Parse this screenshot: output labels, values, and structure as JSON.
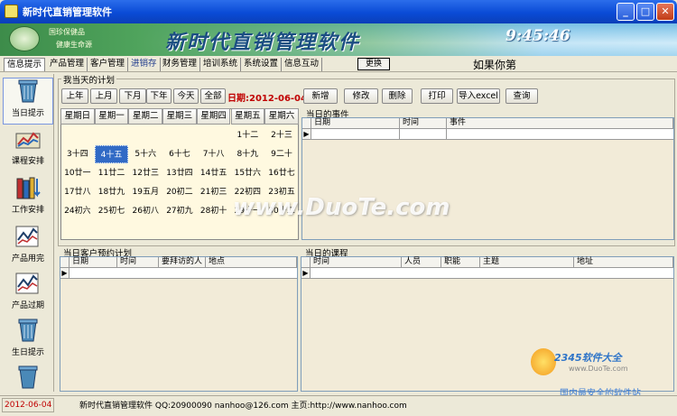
{
  "window": {
    "title": "新时代直销管理软件"
  },
  "banner": {
    "slogan1": "国珍保健品",
    "slogan2": "健康生命源",
    "title": "新时代直销管理软件",
    "clock": "9:45:46"
  },
  "menu": {
    "tabs": [
      "信息提示",
      "产品管理",
      "客户管理",
      "进销存",
      "财务管理",
      "培训系统",
      "系统设置",
      "信息互动"
    ],
    "change_button": "更换",
    "motto": "如果你第"
  },
  "sidebar": {
    "items": [
      {
        "label": "当日提示",
        "icon": "trash-can-icon"
      },
      {
        "label": "课程安排",
        "icon": "chart-book-icon"
      },
      {
        "label": "工作安排",
        "icon": "books-arrow-icon"
      },
      {
        "label": "产品用完",
        "icon": "clipboard-graph-icon"
      },
      {
        "label": "产品过期",
        "icon": "clipboard-graph-icon"
      },
      {
        "label": "生日提示",
        "icon": "trash-can-icon"
      }
    ]
  },
  "plan": {
    "group_label": "我当天的计划",
    "nav_buttons": [
      "上年",
      "上月",
      "下月",
      "下年",
      "今天",
      "全部"
    ],
    "date_label": "日期:2012-06-04",
    "action_buttons": [
      "新增",
      "修改",
      "删除",
      "打印",
      "导入excel",
      "查询"
    ]
  },
  "calendar": {
    "weekdays": [
      "星期日",
      "星期一",
      "星期二",
      "星期三",
      "星期四",
      "星期五",
      "星期六"
    ],
    "rows": [
      [
        "",
        "",
        "",
        "",
        "",
        "1十二",
        "2十三"
      ],
      [
        "3十四",
        "4十五",
        "5十六",
        "6十七",
        "7十八",
        "8十九",
        "9二十"
      ],
      [
        "10廿一",
        "11廿二",
        "12廿三",
        "13廿四",
        "14廿五",
        "15廿六",
        "16廿七"
      ],
      [
        "17廿八",
        "18廿九",
        "19五月",
        "20初二",
        "21初三",
        "22初四",
        "23初五"
      ],
      [
        "24初六",
        "25初七",
        "26初八",
        "27初九",
        "28初十",
        "29十一",
        "30十二"
      ]
    ],
    "selected_day": "4十五"
  },
  "events": {
    "group_label": "当日的事件",
    "columns": [
      "日期",
      "时间",
      "事件"
    ]
  },
  "appointments": {
    "group_label": "当日客户预约计划",
    "columns": [
      "日期",
      "时间",
      "要拜访的人",
      "地点"
    ]
  },
  "courses": {
    "group_label": "当日的课程",
    "columns": [
      "时间",
      "人员",
      "职能",
      "主题",
      "地址"
    ]
  },
  "watermark": {
    "main": "www.DuoTe.com",
    "brand": "2345软件大全",
    "brand_sub": "www.DuoTe.com",
    "tagline": "国内最安全的软件站"
  },
  "status": {
    "date": "2012-06-04",
    "info": "新时代直销管理软件 QQ:20900090 nanhoo@126.com 主页:http://www.nanhoo.com"
  },
  "colors": {
    "titlebar": "#0A4BD6",
    "highlight_red": "#C00000",
    "selection": "#316AC5",
    "panel_bg": "#F2EBD8"
  }
}
